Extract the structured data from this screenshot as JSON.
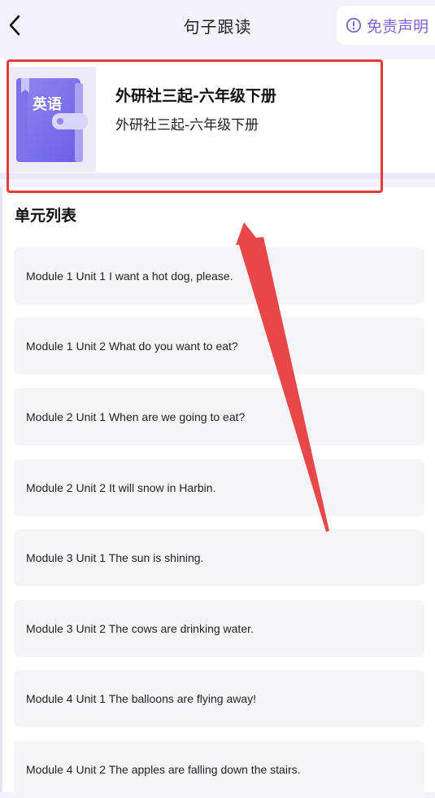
{
  "header": {
    "title": "句子跟读",
    "disclaimer_label": "免责声明"
  },
  "book": {
    "cover_label": "英语",
    "title": "外研社三起-六年级下册",
    "subtitle": "外研社三起-六年级下册"
  },
  "units": {
    "section_title": "单元列表",
    "items": [
      {
        "label": "Module 1 Unit 1 I want a hot dog, please."
      },
      {
        "label": "Module 1 Unit 2 What do you want to eat?"
      },
      {
        "label": "Module 2 Unit 1 When are we going to eat?"
      },
      {
        "label": "Module 2 Unit 2 It will snow in Harbin."
      },
      {
        "label": "Module 3 Unit 1 The sun is shining."
      },
      {
        "label": "Module 3 Unit 2 The cows are drinking water."
      },
      {
        "label": "Module 4 Unit 1 The balloons are flying away!"
      },
      {
        "label": "Module 4 Unit 2 The apples are falling down the stairs."
      }
    ]
  },
  "colors": {
    "accent": "#7a62e0",
    "annotation_red": "#e53a3a",
    "book_cover": "#8f86f0"
  },
  "icons": {
    "back": "chevron-left-icon",
    "disclaimer": "info-circle-icon",
    "book": "english-book-icon"
  }
}
